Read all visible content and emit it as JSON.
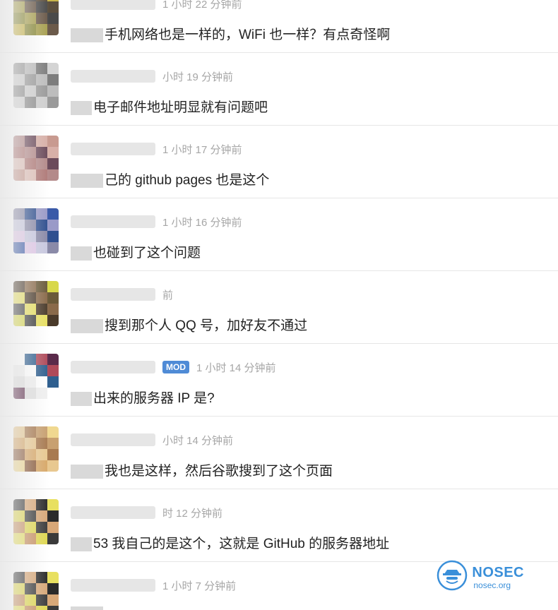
{
  "comments": [
    {
      "time": "1 小时 22 分钟前",
      "text": "手机网络也是一样的，WiFi 也一样？有点奇怪啊",
      "mod": false,
      "avatar_colors": [
        "#6b5a4a",
        "#4a4a4a",
        "#5c4f3e",
        "#c8b54a",
        "#8a8a3a",
        "#a8a050"
      ]
    },
    {
      "time": "小时 19 分钟前",
      "text": "电子邮件地址明显就有问题吧",
      "mod": false,
      "avatar_colors": [
        "#9a9a9a",
        "#bdbdbd",
        "#7d7d7d",
        "#d4d4d4",
        "#8f8f8f",
        "#cfcfcf"
      ]
    },
    {
      "time": "1 小时 17 分钟前",
      "text": "己的 github pages 也是这个",
      "mod": false,
      "avatar_colors": [
        "#b48a8a",
        "#6b4a5a",
        "#d8b0a8",
        "#c89a90",
        "#e0c0b8",
        "#b07a78"
      ]
    },
    {
      "time": "1 小时 16 分钟前",
      "text": "也碰到了这个问题",
      "mod": false,
      "avatar_colors": [
        "#8a8aa8",
        "#2f4f8f",
        "#9a9ac8",
        "#3a5aa8",
        "#e0c8e8",
        "#c8c8e0"
      ]
    },
    {
      "time": "前",
      "text": "搜到那个人 QQ 号，加好友不通过",
      "mod": false,
      "avatar_colors": [
        "#4a3a2a",
        "#8a6a4a",
        "#6a5a3a",
        "#d8d84a",
        "#3a3a3a",
        "#e8e060"
      ]
    },
    {
      "time": "1 小时 14 分钟前",
      "text": "出来的服务器 IP 是?",
      "mod": true,
      "mod_label": "MOD",
      "avatar_colors": [
        "#ffffff",
        "#2f5f8f",
        "#b04a5a",
        "#5a2a4a",
        "#e0e0e0",
        "#f0f0f0"
      ]
    },
    {
      "time": "小时 14 分钟前",
      "text": "我也是这样，然后谷歌搜到了这个页面",
      "mod": false,
      "avatar_colors": [
        "#e8c890",
        "#a87a50",
        "#c8a070",
        "#f0d890",
        "#8a5a3a",
        "#d8a868"
      ]
    },
    {
      "time": "时 12 分钟前",
      "text": "53 我自己的是这个，这就是 GitHub 的服务器地址",
      "mod": false,
      "avatar_colors": [
        "#3a3a3a",
        "#d8a878",
        "#2a2a2a",
        "#e8e060",
        "#c89060",
        "#e0d850"
      ]
    },
    {
      "time": "1 小时 7 分钟前",
      "text": "",
      "mod": false,
      "avatar_colors": [
        "#3a3a3a",
        "#d8a878",
        "#2a2a2a",
        "#e8e060",
        "#c89060",
        "#e0d850"
      ]
    }
  ],
  "watermark": {
    "brand": "NOSEC",
    "site": "nosec.org",
    "icon": "nosec-logo-icon"
  },
  "colors": {
    "accent": "#3a8fd9",
    "mod_badge": "#4f8bd6",
    "time_text": "#a6a6a6",
    "body_text": "#222222",
    "divider": "#e6e6e6"
  }
}
